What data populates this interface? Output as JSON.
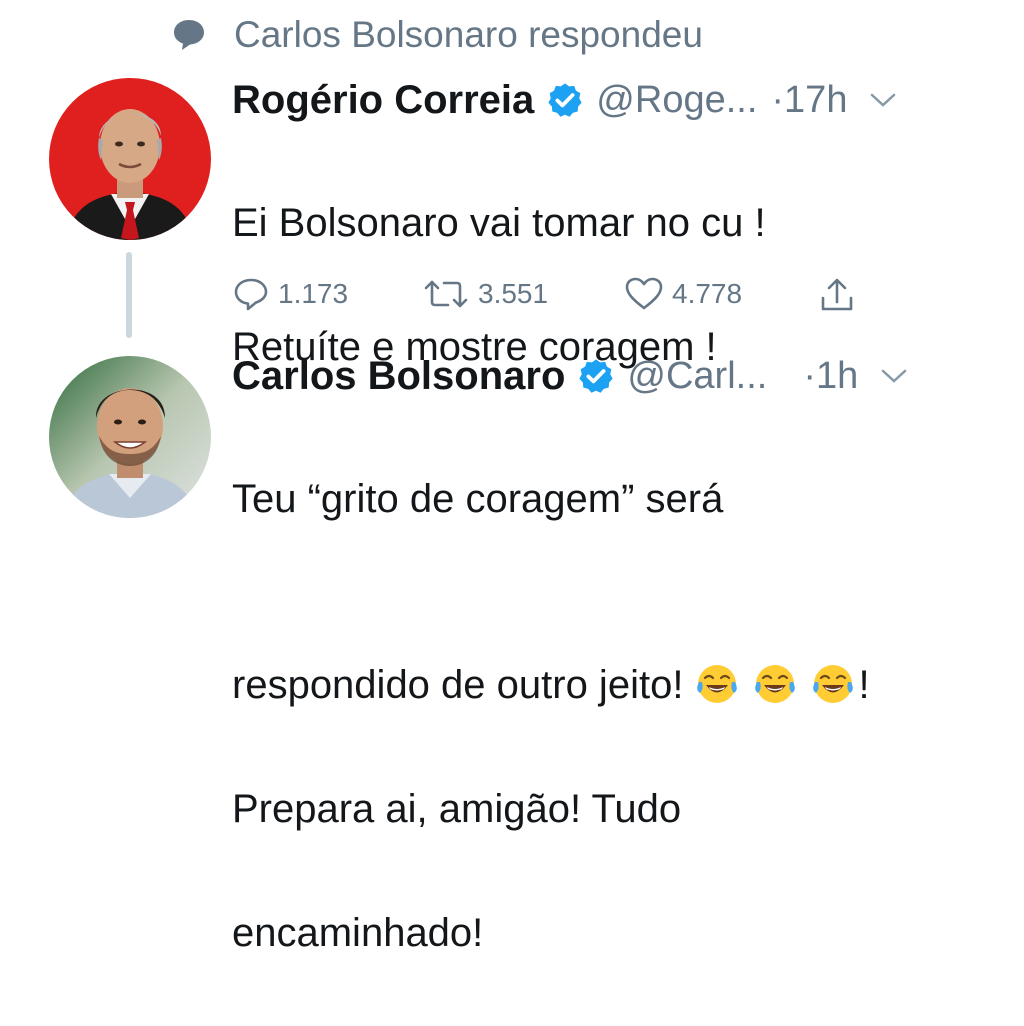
{
  "context": {
    "icon": "speech-bubble-icon",
    "text": "Carlos Bolsonaro respondeu"
  },
  "tweets": [
    {
      "name": "Rogério Correia",
      "handle": "@Roge...",
      "separator": "·",
      "time": "17h",
      "text_lines": [
        "Ei Bolsonaro vai tomar no cu !",
        "Retuíte e mostre coragem !"
      ],
      "avatar_bg": "#e0201f",
      "actions": {
        "replies": "1.173",
        "retweets": "3.551",
        "likes": "4.778"
      }
    },
    {
      "name": "Carlos Bolsonaro",
      "handle": "@Carl...",
      "separator": "·",
      "time": "1h",
      "text_line1": "Teu “grito de coragem” será",
      "text_line2": "respondido de outro jeito! ",
      "text_line2_end": "!",
      "text_line3": "Prepara ai, amigão! Tudo",
      "text_line4": "encaminhado!",
      "emoji": "face-with-tears-of-joy-icon"
    }
  ],
  "colors": {
    "verified": "#1da1f2",
    "secondary": "#657786",
    "primary_text": "#14171a"
  }
}
